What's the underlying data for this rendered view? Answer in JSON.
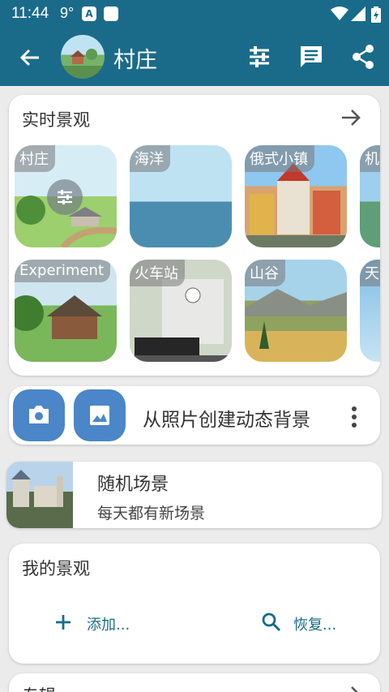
{
  "status": {
    "time": "11:44",
    "temp": "9°",
    "app_badge": "A"
  },
  "appbar": {
    "title": "村庄"
  },
  "live": {
    "title": "实时景观",
    "tiles": [
      {
        "label": "村庄"
      },
      {
        "label": "海洋"
      },
      {
        "label": "俄式小镇"
      },
      {
        "label": "机场"
      },
      {
        "label": "Experiment"
      },
      {
        "label": "火车站"
      },
      {
        "label": "山谷"
      },
      {
        "label": "天空"
      }
    ]
  },
  "photo": {
    "label": "从照片创建动态背景"
  },
  "random": {
    "title": "随机场景",
    "subtitle": "每天都有新场景"
  },
  "mine": {
    "title": "我的景观",
    "add_label": "添加...",
    "restore_label": "恢复..."
  },
  "next_section": {
    "title": "专辑"
  }
}
